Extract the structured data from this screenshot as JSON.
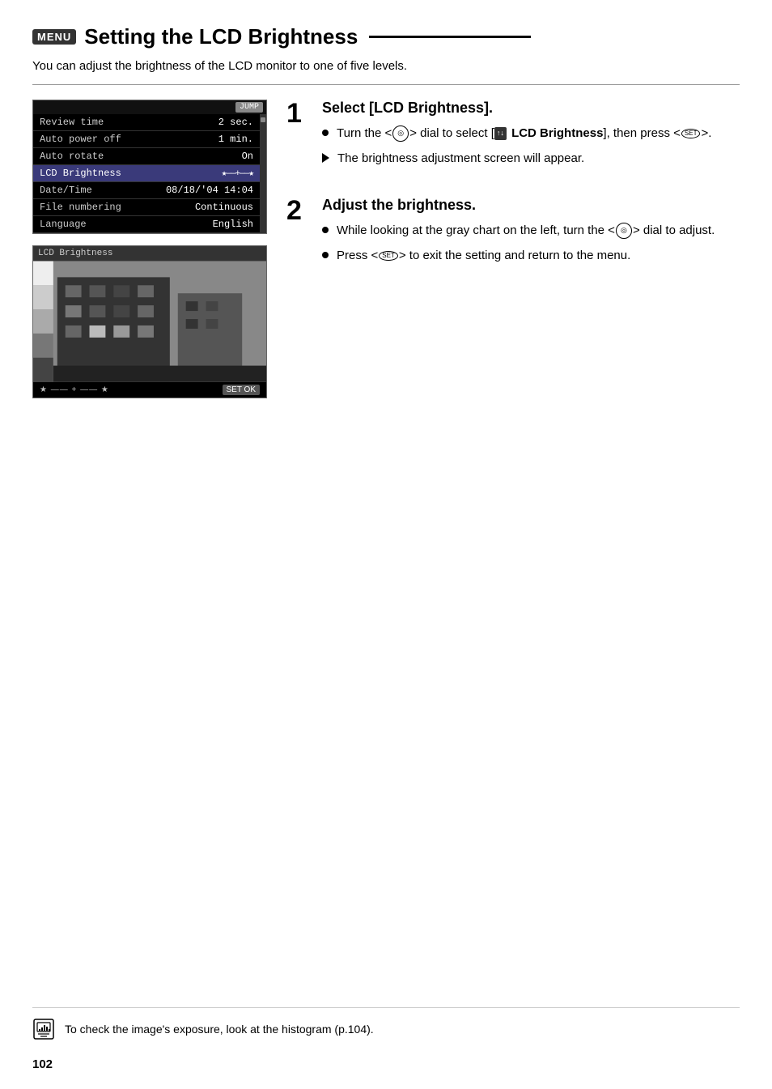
{
  "header": {
    "menu_badge": "MENU",
    "title": "Setting the LCD Brightness",
    "subtitle": "You can adjust the brightness of the LCD monitor to one of five levels."
  },
  "menu_screenshot": {
    "jump_label": "JUMP",
    "rows": [
      {
        "label": "Review time",
        "value": "2 sec.",
        "selected": false
      },
      {
        "label": "Auto power off",
        "value": "1 min.",
        "selected": false
      },
      {
        "label": "Auto rotate",
        "value": "On",
        "selected": false
      },
      {
        "label": "LCD Brightness",
        "value": "★——+——★",
        "selected": true
      },
      {
        "label": "Date/Time",
        "value": "08/18/'04 14:04",
        "selected": false
      },
      {
        "label": "File numbering",
        "value": "Continuous",
        "selected": false
      },
      {
        "label": "Language",
        "value": "English",
        "selected": false
      }
    ]
  },
  "lcd_screenshot": {
    "title": "LCD Brightness",
    "set_ok": "SET OK"
  },
  "steps": [
    {
      "number": "1",
      "heading": "Select [LCD Brightness].",
      "bullets": [
        {
          "type": "dot",
          "text_before": "Turn the <",
          "dial": "◎",
          "text_middle": "> dial to select [",
          "menu_icon": "↑↓",
          "bold_text": "LCD Brightness",
          "text_after": "], then press <",
          "set_text": "SET",
          "text_end": ">."
        },
        {
          "type": "arrow",
          "text": "The brightness adjustment screen will appear."
        }
      ]
    },
    {
      "number": "2",
      "heading": "Adjust the brightness.",
      "bullets": [
        {
          "type": "dot",
          "text": "While looking at the gray chart on the left, turn the <",
          "dial": "◎",
          "text_end": "> dial to adjust."
        },
        {
          "type": "dot",
          "text_before": "Press <",
          "set_text": "SET",
          "text_after": "> to exit the setting and return to the menu."
        }
      ]
    }
  ],
  "footer": {
    "note": "To check the image's exposure, look at the histogram (p.104)."
  },
  "page_number": "102"
}
